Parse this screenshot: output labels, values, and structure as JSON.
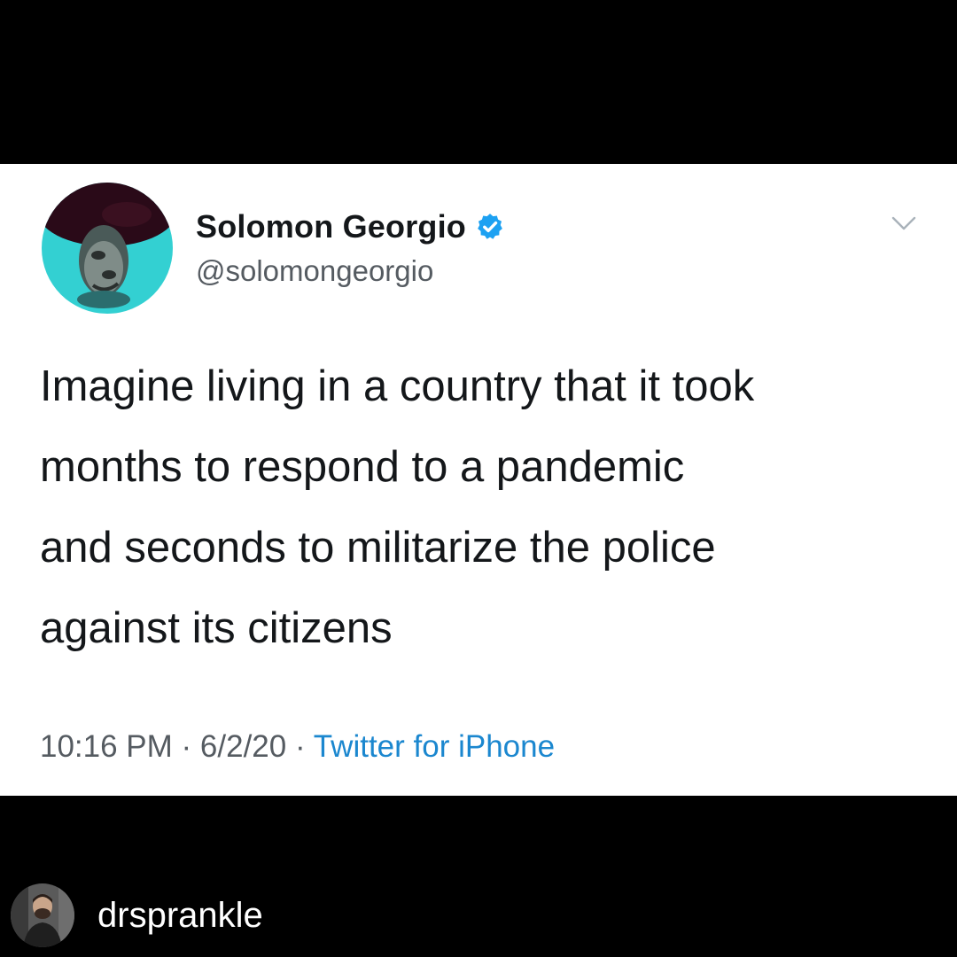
{
  "tweet": {
    "author_name": "Solomon Georgio",
    "author_handle": "@solomongeorgio",
    "verified": true,
    "text": "Imagine living in a country that it took\nmonths to respond to a pandemic\nand seconds to militarize the police\nagainst its citizens",
    "time": "10:16 PM",
    "date": "6/2/20",
    "source": "Twitter for iPhone",
    "separator": " · "
  },
  "repost": {
    "username": "drsprankle"
  },
  "icons": {
    "verified": "verified-badge-icon",
    "menu": "chevron-down-icon"
  },
  "colors": {
    "background": "#000000",
    "card": "#ffffff",
    "text": "#14171a",
    "muted": "#555b61",
    "link": "#1b87cf",
    "verified": "#1da1f2",
    "avatar_accent": "#33d0d2"
  }
}
